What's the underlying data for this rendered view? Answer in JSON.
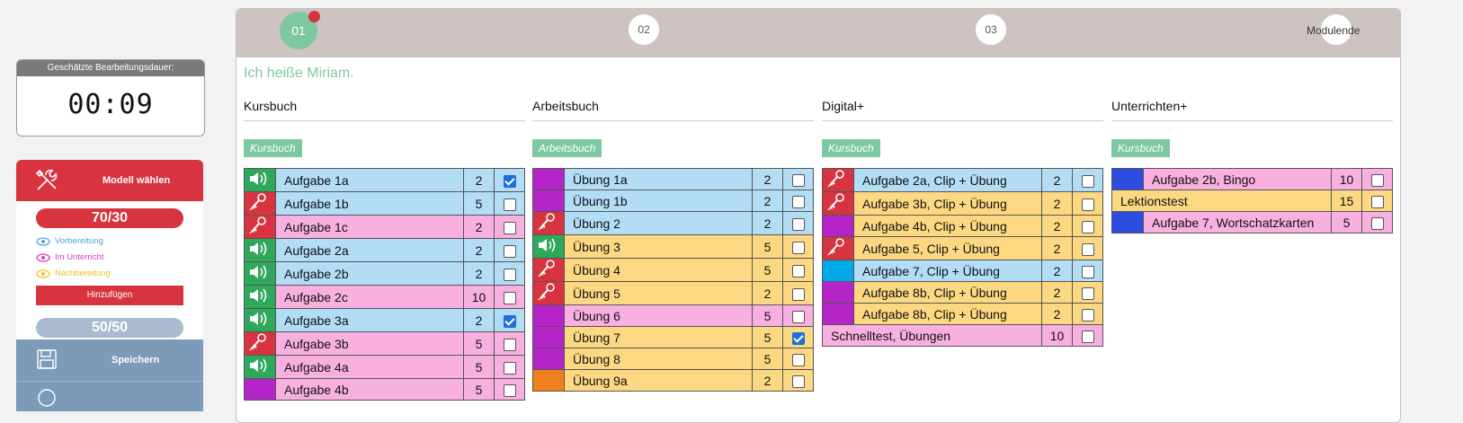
{
  "timer": {
    "label": "Geschätzte Bearbeitungsdauer:",
    "value": "00:09"
  },
  "sidebar": {
    "model_label": "Modell wählen",
    "score_primary": "70/30",
    "legend": [
      {
        "label": "Vorbereitung",
        "color": "#4aa3df"
      },
      {
        "label": "Im Unterricht",
        "color": "#d63bbf"
      },
      {
        "label": "Nachbereitung",
        "color": "#f0c02a"
      }
    ],
    "add_label": "Hinzufügen",
    "score_secondary": "50/50",
    "save_label": "Speichern"
  },
  "steps": {
    "s1": "01",
    "s2": "02",
    "s3": "03",
    "end": "Modulende"
  },
  "greeting": "Ich heiße Miriam.",
  "columns": [
    {
      "title": "Kursbuch",
      "tag": "Kursbuch",
      "rows": [
        {
          "icon": "audio-icon",
          "icon_color": "green",
          "row_color": "blue",
          "name": "Aufgabe 1a",
          "num": "2",
          "checked": true
        },
        {
          "icon": "mic-icon",
          "icon_color": "red",
          "row_color": "blue",
          "name": "Aufgabe 1b",
          "num": "5",
          "checked": false
        },
        {
          "icon": "mic-icon",
          "icon_color": "red",
          "row_color": "pink",
          "name": "Aufgabe 1c",
          "num": "2",
          "checked": false
        },
        {
          "icon": "audio-icon",
          "icon_color": "green",
          "row_color": "blue",
          "name": "Aufgabe 2a",
          "num": "2",
          "checked": false
        },
        {
          "icon": "audio-icon",
          "icon_color": "green",
          "row_color": "blue",
          "name": "Aufgabe 2b",
          "num": "2",
          "checked": false
        },
        {
          "icon": "audio-icon",
          "icon_color": "green",
          "row_color": "pink",
          "name": "Aufgabe 2c",
          "num": "10",
          "checked": false
        },
        {
          "icon": "audio-icon",
          "icon_color": "green",
          "row_color": "blue",
          "name": "Aufgabe 3a",
          "num": "2",
          "checked": true
        },
        {
          "icon": "mic-icon",
          "icon_color": "red",
          "row_color": "pink",
          "name": "Aufgabe 3b",
          "num": "5",
          "checked": false
        },
        {
          "icon": "audio-icon",
          "icon_color": "green",
          "row_color": "pink",
          "name": "Aufgabe 4a",
          "num": "5",
          "checked": false
        },
        {
          "icon": "",
          "icon_color": "purple",
          "row_color": "pink",
          "name": "Aufgabe 4b",
          "num": "5",
          "checked": false
        }
      ]
    },
    {
      "title": "Arbeitsbuch",
      "tag": "Arbeitsbuch",
      "rows": [
        {
          "icon": "",
          "icon_color": "purple",
          "row_color": "blue",
          "name": "Übung 1a",
          "num": "2",
          "checked": false
        },
        {
          "icon": "",
          "icon_color": "purple",
          "row_color": "blue",
          "name": "Übung 1b",
          "num": "2",
          "checked": false
        },
        {
          "icon": "mic-icon",
          "icon_color": "red",
          "row_color": "blue",
          "name": "Übung 2",
          "num": "2",
          "checked": false
        },
        {
          "icon": "audio-icon",
          "icon_color": "green",
          "row_color": "yellow",
          "name": "Übung 3",
          "num": "5",
          "checked": false
        },
        {
          "icon": "mic-icon",
          "icon_color": "red",
          "row_color": "yellow",
          "name": "Übung 4",
          "num": "5",
          "checked": false
        },
        {
          "icon": "mic-icon",
          "icon_color": "red",
          "row_color": "yellow",
          "name": "Übung 5",
          "num": "2",
          "checked": false
        },
        {
          "icon": "",
          "icon_color": "purple",
          "row_color": "pink",
          "name": "Übung 6",
          "num": "5",
          "checked": false
        },
        {
          "icon": "",
          "icon_color": "purple",
          "row_color": "yellow",
          "name": "Übung 7",
          "num": "5",
          "checked": true
        },
        {
          "icon": "",
          "icon_color": "purple",
          "row_color": "yellow",
          "name": "Übung 8",
          "num": "5",
          "checked": false
        },
        {
          "icon": "",
          "icon_color": "orange",
          "row_color": "yellow",
          "name": "Übung 9a",
          "num": "2",
          "checked": false
        }
      ]
    },
    {
      "title": "Digital+",
      "tag": "Kursbuch",
      "rows": [
        {
          "icon": "mic-icon",
          "icon_color": "red",
          "row_color": "blue",
          "name": "Aufgabe 2a, Clip + Übung",
          "num": "2",
          "checked": false
        },
        {
          "icon": "mic-icon",
          "icon_color": "red",
          "row_color": "yellow",
          "name": "Aufgabe 3b, Clip + Übung",
          "num": "2",
          "checked": false
        },
        {
          "icon": "",
          "icon_color": "purple",
          "row_color": "yellow",
          "name": "Aufgabe 4b, Clip + Übung",
          "num": "2",
          "checked": false
        },
        {
          "icon": "mic-icon",
          "icon_color": "red",
          "row_color": "yellow",
          "name": "Aufgabe 5, Clip + Übung",
          "num": "2",
          "checked": false
        },
        {
          "icon": "",
          "icon_color": "cyan",
          "row_color": "blue",
          "name": "Aufgabe 7, Clip + Übung",
          "num": "2",
          "checked": false
        },
        {
          "icon": "",
          "icon_color": "purple",
          "row_color": "yellow",
          "name": "Aufgabe 8b, Clip + Übung",
          "num": "2",
          "checked": false
        },
        {
          "icon": "",
          "icon_color": "purple",
          "row_color": "yellow",
          "name": "Aufgabe 8b, Clip + Übung",
          "num": "2",
          "checked": false
        },
        {
          "icon": "none",
          "icon_color": "",
          "row_color": "pink",
          "name": "Schnelltest, Übungen",
          "num": "10",
          "checked": false
        }
      ]
    },
    {
      "title": "Unterrichten+",
      "tag": "Kursbuch",
      "rows": [
        {
          "icon": "",
          "icon_color": "navy",
          "row_color": "pink",
          "name": "Aufgabe 2b, Bingo",
          "num": "10",
          "checked": false
        },
        {
          "icon": "none",
          "icon_color": "",
          "row_color": "yellow",
          "name": "Lektionstest",
          "num": "15",
          "checked": false
        },
        {
          "icon": "",
          "icon_color": "navy",
          "row_color": "pink",
          "name": "Aufgabe 7, Wortschatzkarten",
          "num": "5",
          "checked": false
        }
      ]
    }
  ]
}
